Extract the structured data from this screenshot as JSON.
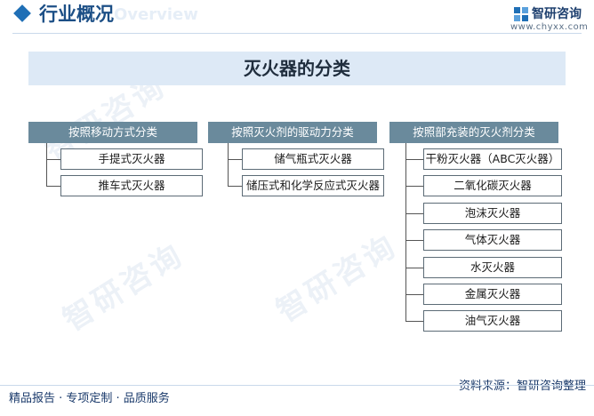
{
  "header": {
    "title": "行业概况",
    "title_watermark": "Overview",
    "logo_name": "智研咨询",
    "logo_url": "www.chyxx.com"
  },
  "diagram": {
    "title": "灭火器的分类",
    "categories": [
      {
        "label": "按照移动方式分类",
        "items": [
          "手提式灭火器",
          "推车式灭火器"
        ]
      },
      {
        "label": "按照灭火剂的驱动力分类",
        "items": [
          "储气瓶式灭火器",
          "储压式和化学反应式灭火器"
        ]
      },
      {
        "label": "按照部充装的灭火剂分类",
        "items": [
          "干粉灭火器（ABC灭火器）",
          "二氧化碳灭火器",
          "泡沫灭火器",
          "气体灭火器",
          "水灭火器",
          "金属灭火器",
          "油气灭火器"
        ]
      }
    ]
  },
  "footer": {
    "left": "精品报告 · 专项定制 · 品质服务",
    "source": "资料来源：智研咨询整理"
  },
  "watermark_text": "智研咨询",
  "colors": {
    "accent": "#1f6fb6",
    "category_bg": "#6a8a9c",
    "banner_bg": "#dde9f6",
    "title_text": "#1c4f86"
  }
}
